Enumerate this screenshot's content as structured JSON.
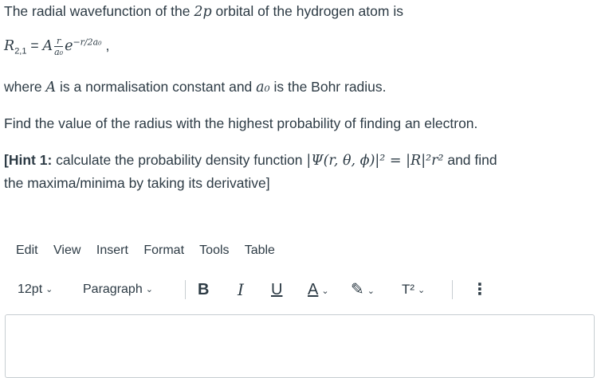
{
  "question": {
    "intro": "The radial wavefunction of the 2p orbital of the hydrogen atom is",
    "intro_orbital": "2p",
    "formula": {
      "lhs": "R",
      "lhs_sub": "2,1",
      "eq": "=",
      "A": "A",
      "frac_num": "r",
      "frac_den": "a₀",
      "exp_base": "e",
      "exponent": "−r/2a₀",
      "trail": ","
    },
    "where_pre": "where ",
    "where_A": "A",
    "where_mid": " is a normalisation constant and ",
    "where_a0": "a₀",
    "where_post": " is the Bohr radius.",
    "find_line": "Find the value of the radius with the highest probability of finding an electron.",
    "hint_label": "[Hint 1:",
    "hint_text": " calculate the probability density function ",
    "hint_math": "|Ψ(r, θ, ϕ)|² = |R|²r²",
    "hint_tail": " and find",
    "hint_line2": "the maxima/minima by taking its derivative]"
  },
  "menubar": {
    "items": [
      "Edit",
      "View",
      "Insert",
      "Format",
      "Tools",
      "Table"
    ]
  },
  "toolbar": {
    "font_size": "12pt",
    "block_format": "Paragraph",
    "bold": "B",
    "italic": "I",
    "underline": "U",
    "text_color": "A",
    "highlight": "✎",
    "superscript": "T²",
    "more": "⋮"
  },
  "colors": {
    "text": "#2d3b45",
    "border": "#c7cdd1",
    "underline_accent": "#2d3b45"
  }
}
